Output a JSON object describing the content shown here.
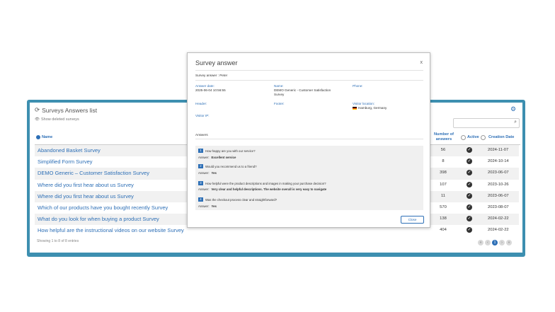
{
  "list": {
    "title": "Surveys Answers list",
    "show_deleted": "Show deleted surveys",
    "columns": {
      "name": "Name",
      "answers": "Number of answers",
      "active": "Active",
      "creation_date": "Creation Date"
    },
    "rows": [
      {
        "name": "Abandoned Basket Survey",
        "answers": "56",
        "date": "2024-11-07"
      },
      {
        "name": "Simplified  Form Survey",
        "answers": "8",
        "date": "2024-10-14"
      },
      {
        "name": "DEMO Generic – Customer Satisfaction Survey",
        "answers": "398",
        "date": "2023-06-07"
      },
      {
        "name": "Where did you first hear about us Survey",
        "answers": "107",
        "date": "2023-10-26"
      },
      {
        "name": "Where did you first hear about us Survey",
        "answers": "11",
        "date": "2023-06-07"
      },
      {
        "name": "Which of our products have you bought recently Survey",
        "answers": "570",
        "date": "2023-08-07"
      },
      {
        "name": "What do you look for when buying a product Survey",
        "answers": "138",
        "date": "2024-02-22"
      },
      {
        "name": "How helpful are the instructional videos on our website Survey",
        "answers": "404",
        "date": "2024-02-22"
      }
    ],
    "showing": "Showing 1 to 8 of 8 entries",
    "pager": {
      "first": "«",
      "prev": "‹",
      "current": "1",
      "next": "›",
      "last": "»"
    },
    "colors": {
      "accent": "#2d6fb6",
      "frame": "#3d8fb0"
    }
  },
  "modal": {
    "title": "Survey answer",
    "close_x": "x",
    "subtitle": "Survey answer : Peter",
    "answer_date_label": "Answer date:",
    "answer_date": "2025-06-04 10:56:55",
    "name_label": "Name:",
    "name_value_1": "DEMO Generic - Customer Satisfaction",
    "name_value_2": "Survey",
    "phone_label": "Phone:",
    "header_label": "Header:",
    "footer_label": "Footer:",
    "visitor_location_label": "Visitor location:",
    "visitor_location": "Hamburg, Germany",
    "visitor_ip_label": "Visitor IP:",
    "answers_label": "Answers",
    "questions": [
      {
        "n": "1",
        "q": "How happy are you with our service?",
        "a_label": "Answer:",
        "a": "Excellent service"
      },
      {
        "n": "2",
        "q": "Would you recommend us to a friend?",
        "a_label": "Answer:",
        "a": "Yes"
      },
      {
        "n": "3",
        "q": "How helpful were the product descriptions and images in making your purchase decision?",
        "a_label": "Answer:",
        "a": "Very clear and helpful descriptions. The website overall is very easy to navigate"
      },
      {
        "n": "4",
        "q": "Was the checkout process clear and straightforward?",
        "a_label": "Answer:",
        "a": "Yes"
      }
    ],
    "close_button": "Close"
  }
}
